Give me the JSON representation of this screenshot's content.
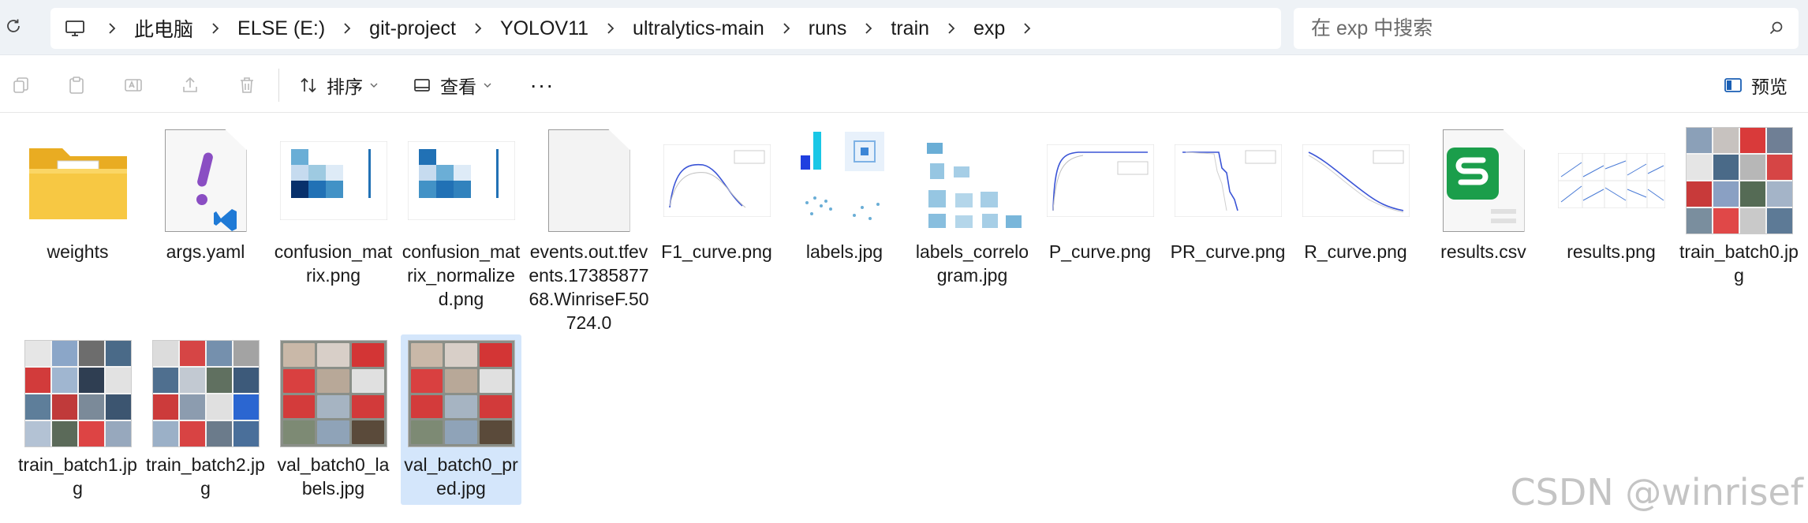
{
  "address_bar": {
    "crumbs": [
      "此电脑",
      "ELSE (E:)",
      "git-project",
      "YOLOV11",
      "ultralytics-main",
      "runs",
      "train",
      "exp"
    ]
  },
  "search": {
    "placeholder": "在 exp 中搜索"
  },
  "toolbar": {
    "sort_label": "排序",
    "view_label": "查看",
    "more_label": "···",
    "preview_label": "预览"
  },
  "files": [
    {
      "name": "weights",
      "type": "folder"
    },
    {
      "name": "args.yaml",
      "type": "yaml"
    },
    {
      "name": "confusion_matrix.png",
      "type": "matrix"
    },
    {
      "name": "confusion_matrix_normalized.png",
      "type": "matrix"
    },
    {
      "name": "events.out.tfevents.1738587768.WinriseF.50724.0",
      "type": "generic"
    },
    {
      "name": "F1_curve.png",
      "type": "curve"
    },
    {
      "name": "labels.jpg",
      "type": "labels"
    },
    {
      "name": "labels_correlogram.jpg",
      "type": "correlogram"
    },
    {
      "name": "P_curve.png",
      "type": "curve"
    },
    {
      "name": "PR_curve.png",
      "type": "curve"
    },
    {
      "name": "R_curve.png",
      "type": "curve"
    },
    {
      "name": "results.csv",
      "type": "csv"
    },
    {
      "name": "results.png",
      "type": "results"
    },
    {
      "name": "train_batch0.jpg",
      "type": "collage"
    },
    {
      "name": "train_batch1.jpg",
      "type": "collage"
    },
    {
      "name": "train_batch2.jpg",
      "type": "collage"
    },
    {
      "name": "val_batch0_labels.jpg",
      "type": "valgrid"
    },
    {
      "name": "val_batch0_pred.jpg",
      "type": "valgrid",
      "selected": true
    }
  ],
  "watermark": "CSDN @winrisef",
  "colors": {
    "topbar_bg": "#eef2f6",
    "selection": "#d4e6fb",
    "folder": "#f5c33b",
    "yaml_accent": "#8a4ec3",
    "csv_green": "#1b9e4b"
  }
}
